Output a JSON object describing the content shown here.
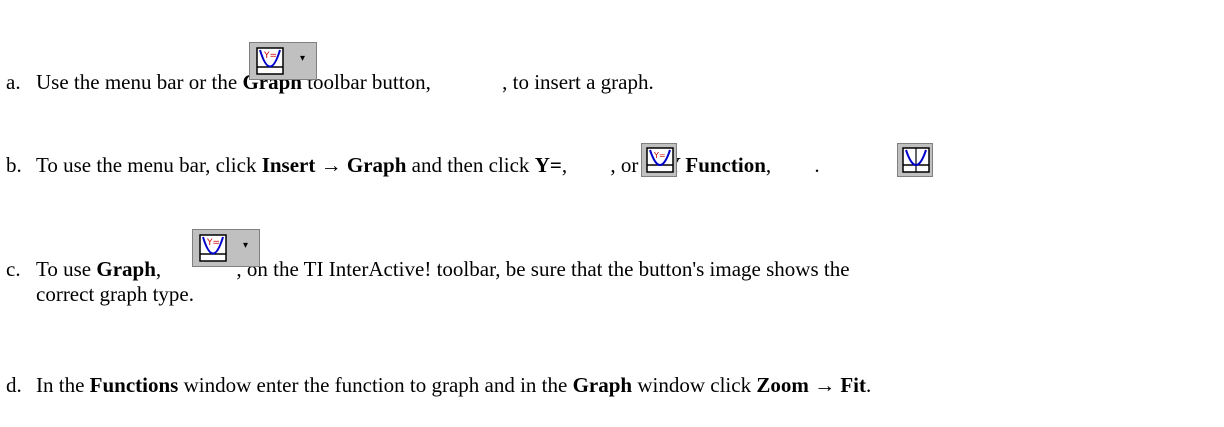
{
  "items": [
    {
      "marker": "a.",
      "t1": "Use  the menu bar or the ",
      "b1": "Graph",
      "t2": " toolbar button, ",
      "t3": ", to insert a graph."
    },
    {
      "marker": "b.",
      "t1": "To use the menu bar, click ",
      "b1": "Insert",
      "arrow": "→",
      "b2": "Graph",
      "t2": " and then click ",
      "b3": "Y=",
      "t3": ", ",
      "t4": ", or ",
      "b4": "X-Y Function",
      "t5": ", ",
      "t6": "."
    },
    {
      "marker": "c.",
      "t1": "To use ",
      "b1": "Graph",
      "t2": ", ",
      "t3": ", on the TI InterActive! toolbar, be sure that the button's image shows the",
      "t4": "correct graph type."
    },
    {
      "marker": "d.",
      "t1": "In the ",
      "b1": "Functions",
      "t2": " window enter the function to graph and in the ",
      "b2": "Graph",
      "t3": " window click ",
      "b3": "Zoom",
      "arrow": "→",
      "b4": "Fit",
      "t4": "."
    }
  ],
  "icons": {
    "graph_button": "graph-toolbar-icon",
    "yequals_button": "y-equals-graph-icon",
    "xy_button": "xy-function-graph-icon",
    "dropdown": "dropdown-caret-icon",
    "bg": "#c0c0c0",
    "accent_red": "#cc0000",
    "accent_blue": "#0000cc"
  }
}
